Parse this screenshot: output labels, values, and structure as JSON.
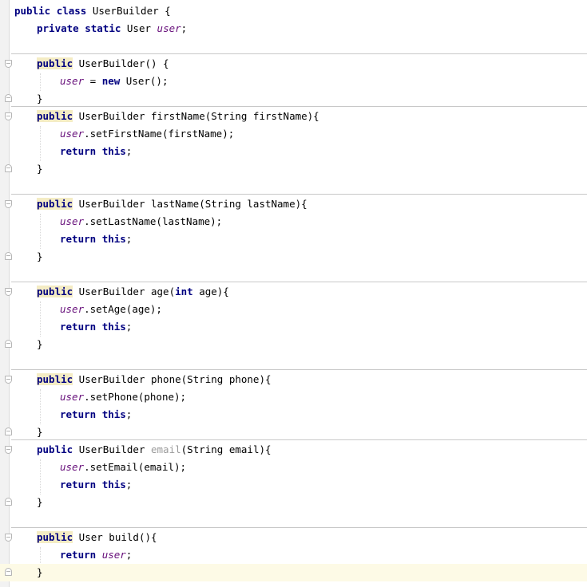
{
  "editor": {
    "language": "java",
    "lines": [
      {
        "tokens": [
          {
            "t": "public ",
            "c": "kw"
          },
          {
            "t": "class ",
            "c": "kw"
          },
          {
            "t": "UserBuilder {",
            "c": "plain"
          }
        ]
      },
      {
        "tokens": [
          {
            "t": "private ",
            "c": "kw"
          },
          {
            "t": "static ",
            "c": "kw"
          },
          {
            "t": "User ",
            "c": "plain"
          },
          {
            "t": "user",
            "c": "field"
          },
          {
            "t": ";",
            "c": "plain"
          }
        ]
      },
      {
        "tokens": []
      },
      {
        "tokens": [
          {
            "t": "public",
            "c": "kw-hl"
          },
          {
            "t": " UserBuilder() {",
            "c": "plain"
          }
        ]
      },
      {
        "tokens": [
          {
            "t": "user",
            "c": "field"
          },
          {
            "t": " = ",
            "c": "plain"
          },
          {
            "t": "new ",
            "c": "kw"
          },
          {
            "t": "User();",
            "c": "plain"
          }
        ]
      },
      {
        "tokens": [
          {
            "t": "}",
            "c": "plain"
          }
        ]
      },
      {
        "tokens": [
          {
            "t": "public",
            "c": "kw-hl"
          },
          {
            "t": " UserBuilder firstName(String firstName){",
            "c": "plain"
          }
        ]
      },
      {
        "tokens": [
          {
            "t": "user",
            "c": "field"
          },
          {
            "t": ".setFirstName(firstName);",
            "c": "plain"
          }
        ]
      },
      {
        "tokens": [
          {
            "t": "return ",
            "c": "kw"
          },
          {
            "t": "this",
            "c": "kw"
          },
          {
            "t": ";",
            "c": "plain"
          }
        ]
      },
      {
        "tokens": [
          {
            "t": "}",
            "c": "plain"
          }
        ]
      },
      {
        "tokens": []
      },
      {
        "tokens": [
          {
            "t": "public",
            "c": "kw-hl"
          },
          {
            "t": " UserBuilder lastName(String lastName){",
            "c": "plain"
          }
        ]
      },
      {
        "tokens": [
          {
            "t": "user",
            "c": "field"
          },
          {
            "t": ".setLastName(lastName);",
            "c": "plain"
          }
        ]
      },
      {
        "tokens": [
          {
            "t": "return ",
            "c": "kw"
          },
          {
            "t": "this",
            "c": "kw"
          },
          {
            "t": ";",
            "c": "plain"
          }
        ]
      },
      {
        "tokens": [
          {
            "t": "}",
            "c": "plain"
          }
        ]
      },
      {
        "tokens": []
      },
      {
        "tokens": [
          {
            "t": "public",
            "c": "kw-hl"
          },
          {
            "t": " UserBuilder age(",
            "c": "plain"
          },
          {
            "t": "int",
            "c": "kw"
          },
          {
            "t": " age){",
            "c": "plain"
          }
        ]
      },
      {
        "tokens": [
          {
            "t": "user",
            "c": "field"
          },
          {
            "t": ".setAge(age);",
            "c": "plain"
          }
        ]
      },
      {
        "tokens": [
          {
            "t": "return ",
            "c": "kw"
          },
          {
            "t": "this",
            "c": "kw"
          },
          {
            "t": ";",
            "c": "plain"
          }
        ]
      },
      {
        "tokens": [
          {
            "t": "}",
            "c": "plain"
          }
        ]
      },
      {
        "tokens": []
      },
      {
        "tokens": [
          {
            "t": "public",
            "c": "kw-hl"
          },
          {
            "t": " UserBuilder phone(String phone){",
            "c": "plain"
          }
        ]
      },
      {
        "tokens": [
          {
            "t": "user",
            "c": "field"
          },
          {
            "t": ".setPhone(phone);",
            "c": "plain"
          }
        ]
      },
      {
        "tokens": [
          {
            "t": "return ",
            "c": "kw"
          },
          {
            "t": "this",
            "c": "kw"
          },
          {
            "t": ";",
            "c": "plain"
          }
        ]
      },
      {
        "tokens": [
          {
            "t": "}",
            "c": "plain"
          }
        ]
      },
      {
        "tokens": [
          {
            "t": "public ",
            "c": "kw"
          },
          {
            "t": "UserBuilder ",
            "c": "plain"
          },
          {
            "t": "email",
            "c": "unused"
          },
          {
            "t": "(String email){",
            "c": "plain"
          }
        ]
      },
      {
        "tokens": [
          {
            "t": "user",
            "c": "field"
          },
          {
            "t": ".setEmail(email);",
            "c": "plain"
          }
        ]
      },
      {
        "tokens": [
          {
            "t": "return ",
            "c": "kw"
          },
          {
            "t": "this",
            "c": "kw"
          },
          {
            "t": ";",
            "c": "plain"
          }
        ]
      },
      {
        "tokens": [
          {
            "t": "}",
            "c": "plain"
          }
        ]
      },
      {
        "tokens": []
      },
      {
        "tokens": [
          {
            "t": "public",
            "c": "kw-hl"
          },
          {
            "t": " User build(){",
            "c": "plain"
          }
        ]
      },
      {
        "tokens": [
          {
            "t": "return ",
            "c": "kw"
          },
          {
            "t": "user",
            "c": "field"
          },
          {
            "t": ";",
            "c": "plain"
          }
        ]
      },
      {
        "tokens": [
          {
            "t": "}",
            "c": "plain"
          }
        ]
      }
    ],
    "caret_line": 32,
    "colors": {
      "keyword": "#000080",
      "field": "#660e7a",
      "unused": "#9a9a9a",
      "keyword_highlight": "#f4ecc4",
      "current_line": "#fdfae6"
    }
  }
}
